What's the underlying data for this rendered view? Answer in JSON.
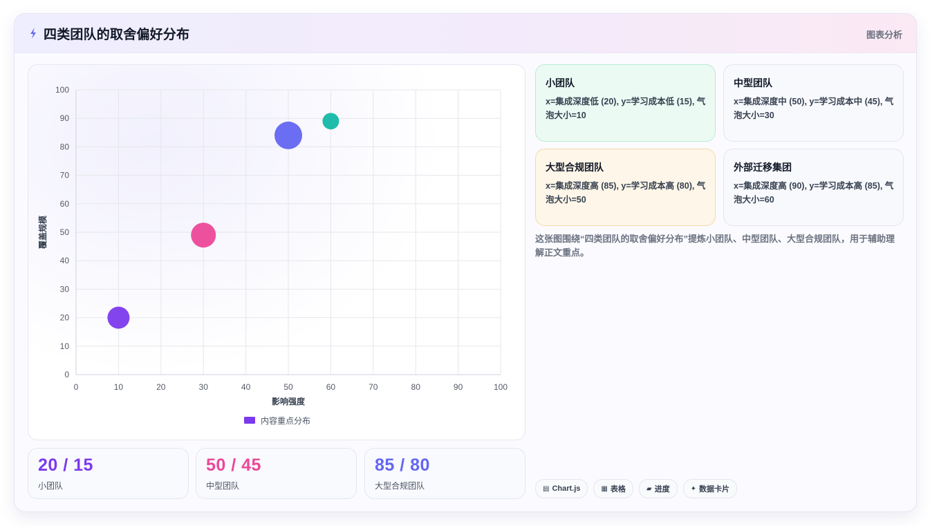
{
  "header": {
    "icon": "sparkle-bolt-icon",
    "title": "四类团队的取舍偏好分布",
    "right_label": "图表分析"
  },
  "chart_data": {
    "type": "scatter",
    "bubble": true,
    "xlabel": "影响强度",
    "ylabel": "覆盖规模",
    "xlim": [
      0,
      100
    ],
    "ylim": [
      0,
      100
    ],
    "x_ticks": [
      "0",
      "10",
      "20",
      "30",
      "40",
      "50",
      "60",
      "70",
      "80",
      "90",
      "100"
    ],
    "y_ticks": [
      "0",
      "10",
      "20",
      "30",
      "40",
      "50",
      "60",
      "70",
      "80",
      "90",
      "100"
    ],
    "grid": true,
    "legend": {
      "placement": "bottom",
      "label": "内容重点分布",
      "color": "#7c3aed"
    },
    "points": [
      {
        "x": 10,
        "y": 20,
        "r": 16,
        "color": "#7c3aed"
      },
      {
        "x": 30,
        "y": 49,
        "r": 18,
        "color": "#ec4899"
      },
      {
        "x": 50,
        "y": 84,
        "r": 20,
        "color": "#6366f1"
      },
      {
        "x": 60,
        "y": 89,
        "r": 12,
        "color": "#14b8a6"
      }
    ]
  },
  "stats": [
    {
      "value": "20 / 15",
      "label": "小团队",
      "color": "#7c3aed"
    },
    {
      "value": "50 / 45",
      "label": "中型团队",
      "color": "#ec4899"
    },
    {
      "value": "85 / 80",
      "label": "大型合规团队",
      "color": "#6366f1"
    }
  ],
  "info_cards": [
    {
      "title": "小团队",
      "body": "x=集成深度低 (20), y=学习成本低 (15), 气泡大小=10",
      "bg": "#ebfbf3",
      "border": "#b8ebd1"
    },
    {
      "title": "中型团队",
      "body": "x=集成深度中 (50), y=学习成本中 (45), 气泡大小=30",
      "bg": "#f8f9fd",
      "border": "#e3e6f0"
    },
    {
      "title": "大型合规团队",
      "body": "x=集成深度高 (85), y=学习成本高 (80), 气泡大小=50",
      "bg": "#fef6e8",
      "border": "#f5d9a8"
    },
    {
      "title": "外部迁移集团",
      "body": "x=集成深度高 (90), y=学习成本高 (85), 气泡大小=60",
      "bg": "#f8f9fd",
      "border": "#e3e6f0"
    }
  ],
  "description": "这张图围绕“四类团队的取舍偏好分布”提炼小团队、中型团队、大型合规团队，用于辅助理解正文重点。",
  "tags": [
    {
      "icon": "chart-icon",
      "glyph": "▤",
      "label": "Chart.js"
    },
    {
      "icon": "table-icon",
      "glyph": "▦",
      "label": "表格"
    },
    {
      "icon": "progress-icon",
      "glyph": "▰",
      "label": "进度"
    },
    {
      "icon": "sparkle-icon",
      "glyph": "✦",
      "label": "数据卡片"
    }
  ]
}
